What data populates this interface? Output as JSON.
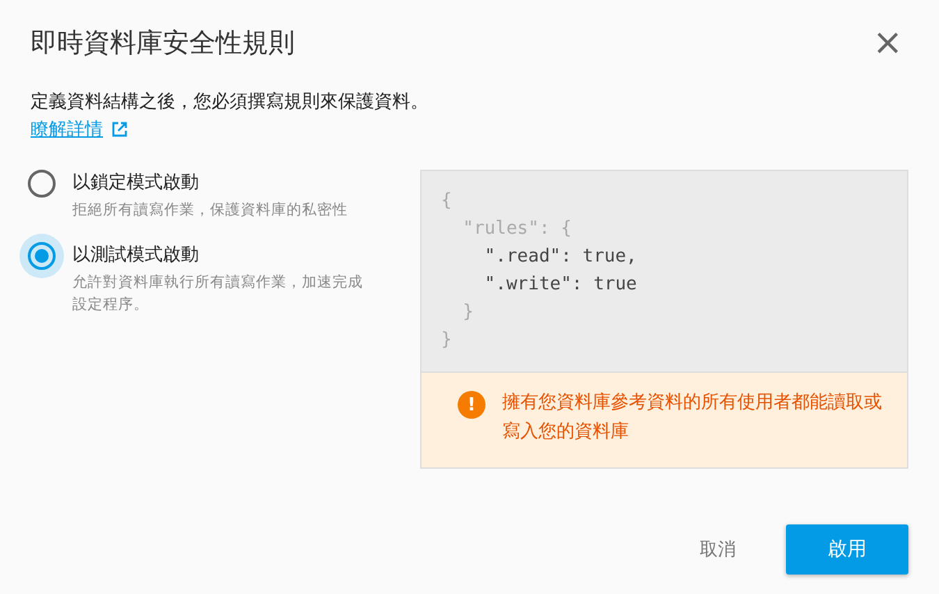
{
  "dialog": {
    "title": "即時資料庫安全性規則",
    "close_label": "×"
  },
  "intro": {
    "text": "定義資料結構之後，您必須撰寫規則來保護資料。",
    "link": "瞭解詳情"
  },
  "options": [
    {
      "label": "以鎖定模式啟動",
      "description": "拒絕所有讀寫作業，保護資料庫的私密性",
      "selected": false
    },
    {
      "label": "以測試模式啟動",
      "description": "允許對資料庫執行所有讀寫作業，加速完成設定程序。",
      "selected": true
    }
  ],
  "code_lines": [
    {
      "text": "{",
      "kind": "muted"
    },
    {
      "text": "  \"rules\": {",
      "kind": "muted"
    },
    {
      "text": "    \".read\": true,",
      "kind": "strong"
    },
    {
      "text": "    \".write\": true",
      "kind": "strong"
    },
    {
      "text": "  }",
      "kind": "muted"
    },
    {
      "text": "}",
      "kind": "muted"
    }
  ],
  "warning": {
    "icon": "!",
    "text": "擁有您資料庫參考資料的所有使用者都能讀取或寫入您的資料庫"
  },
  "buttons": [
    {
      "label": "取消",
      "kind": "text"
    },
    {
      "label": "啟用",
      "kind": "primary"
    }
  ]
}
